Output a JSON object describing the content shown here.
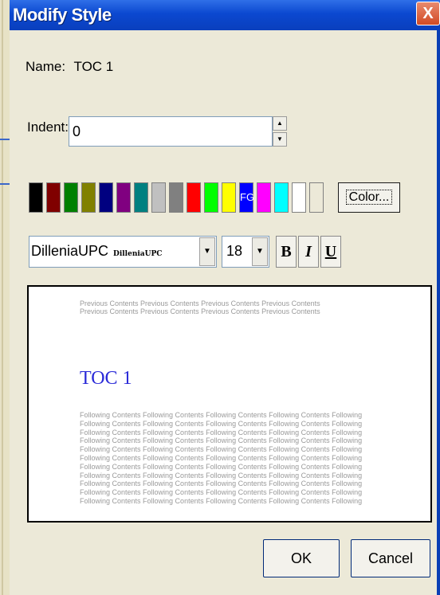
{
  "window": {
    "title": "Modify Style",
    "close_glyph": "X"
  },
  "name": {
    "label": "Name:",
    "value": "TOC 1"
  },
  "indent": {
    "label": "Indent:",
    "value": "0"
  },
  "colors": {
    "swatches": [
      "#000000",
      "#800000",
      "#008000",
      "#808000",
      "#000080",
      "#800080",
      "#008080",
      "#c0c0c0",
      "#808080",
      "#ff0000",
      "#00ff00",
      "#ffff00",
      "#0000ff",
      "#ff00ff",
      "#00ffff",
      "#ffffff",
      "#ece9d8"
    ],
    "selected_label": "FG",
    "button_label": "Color..."
  },
  "font": {
    "name": "DilleniaUPC",
    "sample": "DilleniaUPC",
    "size": "18",
    "bold_label": "B",
    "italic_label": "I",
    "underline_label": "U"
  },
  "preview": {
    "previous_lines": [
      "Previous Contents Previous Contents Previous Contents Previous Contents",
      "Previous Contents Previous Contents Previous Contents Previous Contents"
    ],
    "heading": "TOC 1",
    "following_lines": [
      "Following Contents Following Contents Following Contents Following Contents Following",
      "Following Contents Following Contents Following Contents Following Contents Following",
      "Following Contents Following Contents Following Contents Following Contents Following",
      "Following Contents Following Contents Following Contents Following Contents Following",
      "Following Contents Following Contents Following Contents Following Contents Following",
      "Following Contents Following Contents Following Contents Following Contents Following",
      "Following Contents Following Contents Following Contents Following Contents Following",
      "Following Contents Following Contents Following Contents Following Contents Following",
      "Following Contents Following Contents Following Contents Following Contents Following",
      "Following Contents Following Contents Following Contents Following Contents Following",
      "Following Contents Following Contents Following Contents Following Contents Following"
    ]
  },
  "buttons": {
    "ok": "OK",
    "cancel": "Cancel"
  }
}
